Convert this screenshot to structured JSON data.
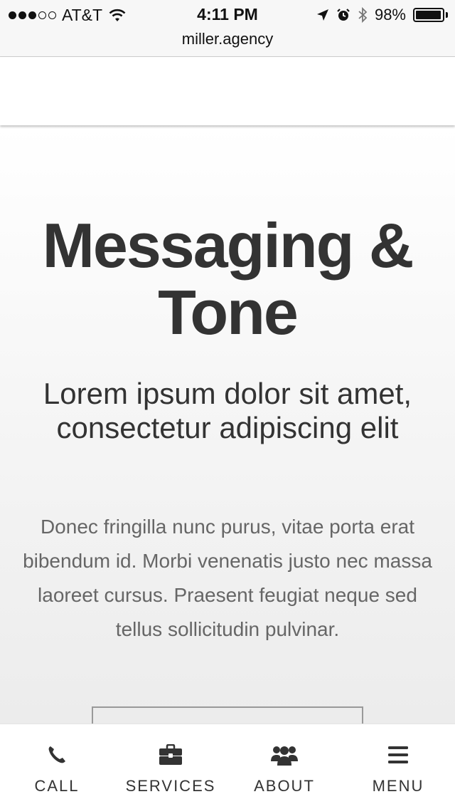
{
  "status_bar": {
    "carrier": "AT&T",
    "time": "4:11 PM",
    "battery": "98%",
    "battery_level": 0.98,
    "signal_bars": 3,
    "signal_total": 5
  },
  "browser": {
    "url": "miller.agency"
  },
  "hero": {
    "title": "Messaging & Tone",
    "subtitle": "Lorem ipsum dolor sit amet, consectetur adipiscing elit",
    "body": "Donec fringilla nunc purus, vitae porta erat bibendum id. Morbi venenatis justo nec massa laoreet cursus. Praesent feugiat neque sed tellus sollicitudin pulvinar."
  },
  "bottom_nav": {
    "items": [
      {
        "label": "CALL",
        "icon": "phone-icon"
      },
      {
        "label": "SERVICES",
        "icon": "briefcase-icon"
      },
      {
        "label": "ABOUT",
        "icon": "users-icon"
      },
      {
        "label": "MENU",
        "icon": "hamburger-icon"
      }
    ]
  },
  "colors": {
    "text": "#333333",
    "body_text": "#666666",
    "background": "#ffffff"
  }
}
